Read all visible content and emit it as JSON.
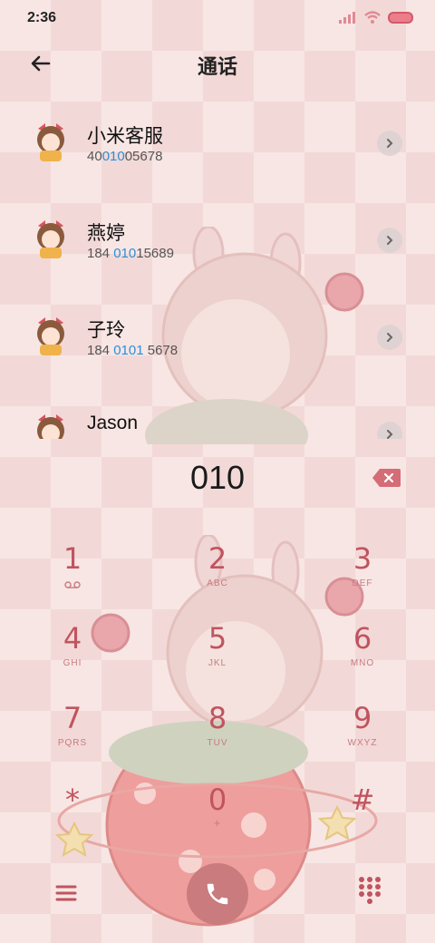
{
  "status_bar": {
    "time": "2:36"
  },
  "header": {
    "title": "通话"
  },
  "contacts": [
    {
      "name": "小米客服",
      "number_pre": "40",
      "number_hl": "010",
      "number_post": "05678"
    },
    {
      "name": "燕婷",
      "number_pre": "184 ",
      "number_hl": "010",
      "number_post": "15689"
    },
    {
      "name": "子玲",
      "number_pre": "184 ",
      "number_hl": "0101",
      "number_post": " 5678"
    },
    {
      "name": "Jason",
      "number_pre": "",
      "number_hl": "",
      "number_post": ""
    }
  ],
  "dial": {
    "number": "010"
  },
  "keypad": [
    {
      "digit": "1",
      "letters": ""
    },
    {
      "digit": "2",
      "letters": "ABC"
    },
    {
      "digit": "3",
      "letters": "DEF"
    },
    {
      "digit": "4",
      "letters": "GHI"
    },
    {
      "digit": "5",
      "letters": "JKL"
    },
    {
      "digit": "6",
      "letters": "MNO"
    },
    {
      "digit": "7",
      "letters": "PQRS"
    },
    {
      "digit": "8",
      "letters": "TUV"
    },
    {
      "digit": "9",
      "letters": "WXYZ"
    },
    {
      "digit": "*",
      "letters": ""
    },
    {
      "digit": "0",
      "letters": "+"
    },
    {
      "digit": "#",
      "letters": ""
    }
  ],
  "icons": {
    "back": "arrow-left-icon",
    "backspace": "backspace-icon",
    "menu": "menu-icon",
    "call": "phone-icon",
    "keypad": "dialpad-icon",
    "voicemail": "voicemail-icon"
  },
  "colors": {
    "accent": "#c0545f",
    "highlight": "#2c8fd6",
    "call_button": "#c97b7d",
    "background": "#f7e6e4"
  }
}
